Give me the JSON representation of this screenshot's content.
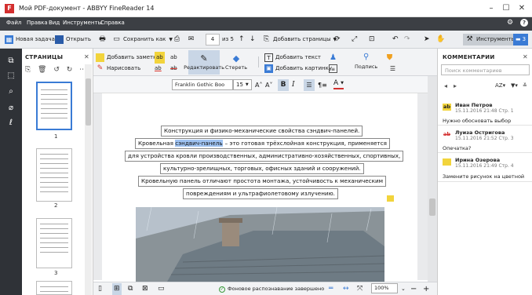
{
  "window": {
    "title": "Мой PDF-документ - ABBYY FineReader 14",
    "logo": "F"
  },
  "menu": [
    "Файл",
    "Правка",
    "Вид",
    "Инструменты",
    "Справка"
  ],
  "toolbar": {
    "new_task": "Новая задача",
    "open": "Открыть",
    "save_as": "Сохранить как",
    "page_current": "4",
    "page_total": "из 5",
    "add_pages": "Добавить страницы",
    "tools": "Инструменты",
    "comments_count": "3"
  },
  "pages_panel": {
    "title": "СТРАНИЦЫ",
    "page_numbers": [
      "1",
      "2",
      "3"
    ]
  },
  "edit_toolbar": {
    "add_note": "Добавить заметку",
    "draw": "Нарисовать",
    "edit": "Редактировать",
    "erase": "Стереть",
    "add_text": "Добавить текст",
    "add_image": "Добавить картинку",
    "signature": "Подпись",
    "ab_label": "ab"
  },
  "format": {
    "font": "Franklin Gothic Boo",
    "size": "15",
    "bold": "B",
    "italic": "I",
    "text_a": "A"
  },
  "document": {
    "lines": [
      "Конструкция и физико-механические свойства сэндвич-панелей.",
      "– это готовая трёхслойная конструкция, применяется",
      "для устройства кровли производственных, административно-хозяйственных, спортивных,",
      "культурно-зрелищных, торговых, офисных зданий и сооружений.",
      "Кровельную панель отличают  простота монтажа, устойчивость к механическим",
      "повреждениям и ультрафиолетовому излучению."
    ],
    "line2_prefix": "Кровельная ",
    "line2_selected": "сэндвич-панель"
  },
  "status": {
    "message": "Фоновое распознавание завершено",
    "zoom": "100%"
  },
  "comments_panel": {
    "title": "КОММЕНТАРИИ",
    "search_placeholder": "Поиск комментариев",
    "items": [
      {
        "author": "Иван Петров",
        "date": "15.11.2016 21:48  Стр. 1",
        "text": "Нужно обосновать выбор",
        "badge": "ab",
        "badge_color": "#f2d43c"
      },
      {
        "author": "Луиза Остригова",
        "date": "15.11.2016 21:52  Стр. 3",
        "text": "Опечатка?",
        "badge": "ab",
        "badge_color": "#ffffff"
      },
      {
        "author": "Ирина Озерова",
        "date": "15.11.2016 21:49  Стр. 4",
        "text": "Замените рисунок на цветной",
        "badge": "",
        "badge_color": "#f2d43c"
      }
    ]
  },
  "colors": {
    "accent": "#3a7bd5",
    "menubar": "#3c3f44",
    "rail": "#2f3237",
    "selection": "#9fc3f2"
  }
}
